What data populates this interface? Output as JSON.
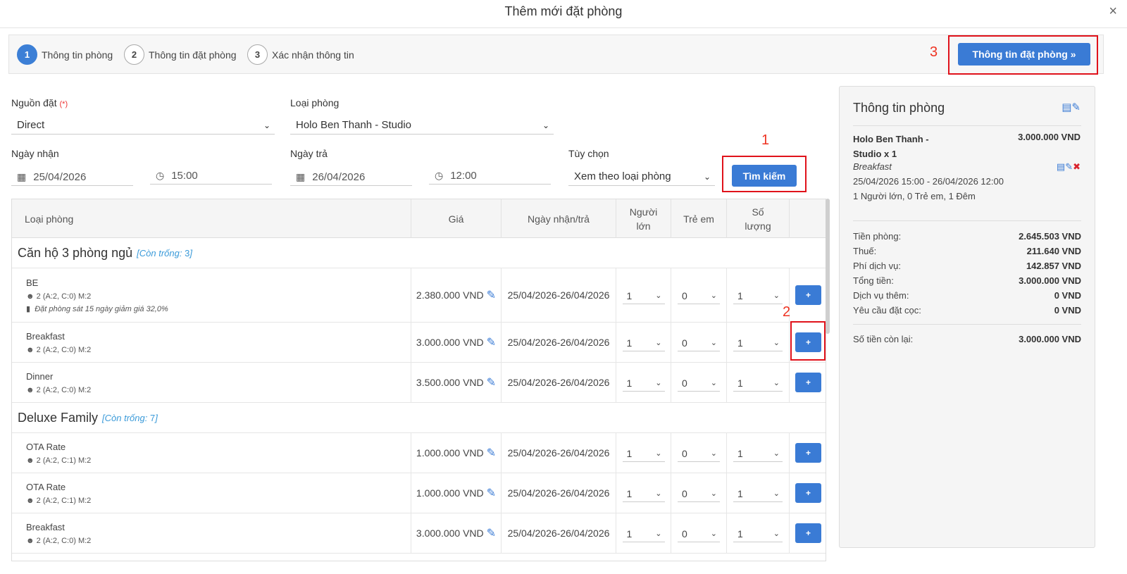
{
  "modal": {
    "title": "Thêm mới đặt phòng",
    "close": "×"
  },
  "steps": [
    {
      "num": "1",
      "label": "Thông tin phòng"
    },
    {
      "num": "2",
      "label": "Thông tin đặt phòng"
    },
    {
      "num": "3",
      "label": "Xác nhận thông tin"
    }
  ],
  "next_button": "Thông tin đặt phòng »",
  "annotations": {
    "a1": "1",
    "a2": "2",
    "a3": "3"
  },
  "form": {
    "source_label": "Nguồn đặt",
    "required_mark": "(*)",
    "source_value": "Direct",
    "room_type_label": "Loại phòng",
    "room_type_value": "Holo Ben Thanh - Studio",
    "checkin_label": "Ngày nhận",
    "checkin_date": "25/04/2026",
    "checkin_time": "15:00",
    "checkout_label": "Ngày trả",
    "checkout_date": "26/04/2026",
    "checkout_time": "12:00",
    "option_label": "Tùy chọn",
    "option_value": "Xem theo loại phòng",
    "search_button": "Tìm kiếm"
  },
  "table": {
    "headers": [
      "Loại phòng",
      "Giá",
      "Ngày nhận/trả",
      "Người lớn",
      "Trẻ em",
      "Số lượng"
    ],
    "groups": [
      {
        "name": "Căn hộ 3 phòng ngủ",
        "avail_label": "[Còn trống: ",
        "avail_count": "3",
        "avail_end": "]"
      },
      {
        "name": "Deluxe Family",
        "avail_label": "[Còn trống: ",
        "avail_count": "7",
        "avail_end": "]"
      }
    ],
    "rows": [
      {
        "name": "BE",
        "cap": "2 (A:2, C:0) M:2",
        "promo": "Đặt phòng sát 15 ngày giảm giá 32,0%",
        "price": "2.380.000 VND",
        "dates": "25/04/2026-26/04/2026",
        "adults": "1",
        "children": "0",
        "qty": "1"
      },
      {
        "name": "Breakfast",
        "cap": "2 (A:2, C:0) M:2",
        "price": "3.000.000 VND",
        "dates": "25/04/2026-26/04/2026",
        "adults": "1",
        "children": "0",
        "qty": "1"
      },
      {
        "name": "Dinner",
        "cap": "2 (A:2, C:0) M:2",
        "price": "3.500.000 VND",
        "dates": "25/04/2026-26/04/2026",
        "adults": "1",
        "children": "0",
        "qty": "1"
      },
      {
        "name": "OTA Rate",
        "cap": "2 (A:2, C:1) M:2",
        "price": "1.000.000 VND",
        "dates": "25/04/2026-26/04/2026",
        "adults": "1",
        "children": "0",
        "qty": "1"
      },
      {
        "name": "OTA Rate",
        "cap": "2 (A:2, C:1) M:2",
        "price": "1.000.000 VND",
        "dates": "25/04/2026-26/04/2026",
        "adults": "1",
        "children": "0",
        "qty": "1"
      },
      {
        "name": "Breakfast",
        "cap": "2 (A:2, C:0) M:2",
        "price": "3.000.000 VND",
        "dates": "25/04/2026-26/04/2026",
        "adults": "1",
        "children": "0",
        "qty": "1"
      }
    ],
    "add_label": "+"
  },
  "panel": {
    "title": "Thông tin phòng",
    "room_name": "Holo Ben Thanh - Studio x 1",
    "room_price": "3.000.000 VND",
    "rate_plan": "Breakfast",
    "stay": "25/04/2026 15:00 - 26/04/2026 12:00",
    "guests": "1 Người lớn, 0 Trẻ em, 1 Đêm",
    "summary": [
      {
        "label": "Tiền phòng:",
        "value": "2.645.503 VND"
      },
      {
        "label": "Thuế:",
        "value": "211.640 VND"
      },
      {
        "label": "Phí dịch vụ:",
        "value": "142.857 VND"
      },
      {
        "label": "Tổng tiền:",
        "value": "3.000.000 VND"
      },
      {
        "label": "Dịch vụ thêm:",
        "value": "0 VND"
      },
      {
        "label": "Yêu cầu đặt cọc:",
        "value": "0 VND"
      }
    ],
    "remaining_label": "Số tiền còn lại:",
    "remaining_value": "3.000.000 VND"
  },
  "colors": {
    "accent": "#3a7bd5",
    "annotation": "#e0121b"
  }
}
